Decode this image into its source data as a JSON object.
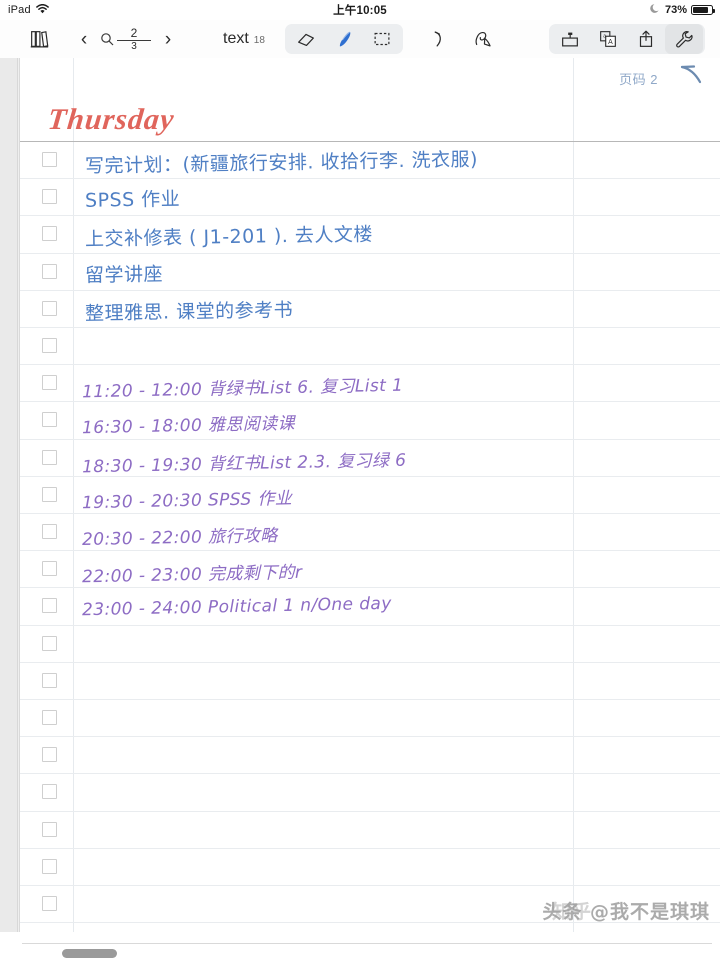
{
  "statusbar": {
    "device": "iPad",
    "wifi_icon": "wifi-icon",
    "time": "上午10:05",
    "dnd_icon": "moon-icon",
    "battery_percent": "73%"
  },
  "toolbar": {
    "library_label": "library-icon",
    "prev_label": "‹",
    "next_label": "›",
    "search_icon": "search-icon",
    "page_current": "2",
    "page_total": "3",
    "text_label": "text",
    "text_size": "18",
    "eraser_label": "eraser-icon",
    "pen_label": "pen-icon",
    "lasso_label": "lasso-select-icon",
    "undo_label": "undo-icon",
    "shape_label": "shape-tool-icon",
    "insert_label": "insert-page-icon",
    "copy_label": "copy-page-icon",
    "share_label": "share-icon",
    "settings_label": "wrench-icon"
  },
  "page": {
    "page_number_label": "页码 2",
    "title": "Thursday",
    "accent_title_color": "#e0655c",
    "ink_blue": "#4f7fc4",
    "ink_purple": "#8d6cc4",
    "tasks": [
      {
        "text": "写完计划：(新疆旅行安排. 收拾行李. 洗衣服)",
        "ink": "blue",
        "checked": false
      },
      {
        "text": "SPSS 作业",
        "ink": "blue",
        "checked": false
      },
      {
        "text": "上交补修表 ( J1-201 ). 去人文楼",
        "ink": "blue",
        "checked": false
      },
      {
        "text": "留学讲座",
        "ink": "blue",
        "checked": false
      },
      {
        "text": "整理雅思. 课堂的参考书",
        "ink": "blue",
        "checked": false
      },
      {
        "text": "",
        "ink": "blue",
        "checked": false
      },
      {
        "text": "11:20 - 12:00 背绿书List 6. 复习List 1",
        "ink": "purple",
        "checked": false
      },
      {
        "text": "16:30 - 18:00 雅思阅读课",
        "ink": "purple",
        "checked": false
      },
      {
        "text": "18:30 - 19:30 背红书List 2.3. 复习绿 6",
        "ink": "purple",
        "checked": false
      },
      {
        "text": "19:30 - 20:30 SPSS 作业",
        "ink": "purple",
        "checked": false
      },
      {
        "text": "20:30 - 22:00 旅行攻略",
        "ink": "purple",
        "checked": false
      },
      {
        "text": "22:00 - 23:00 完成剩下的r",
        "ink": "purple",
        "checked": false
      },
      {
        "text": "23:00 - 24:00 Political 1    n/One day",
        "ink": "purple",
        "checked": false
      },
      {
        "text": "",
        "ink": "blue",
        "checked": false
      },
      {
        "text": "",
        "ink": "blue",
        "checked": false
      },
      {
        "text": "",
        "ink": "blue",
        "checked": false
      },
      {
        "text": "",
        "ink": "blue",
        "checked": false
      },
      {
        "text": "",
        "ink": "blue",
        "checked": false
      },
      {
        "text": "",
        "ink": "blue",
        "checked": false
      },
      {
        "text": "",
        "ink": "blue",
        "checked": false
      },
      {
        "text": "",
        "ink": "blue",
        "checked": false
      },
      {
        "text": "",
        "ink": "blue",
        "checked": false
      }
    ]
  },
  "watermark": {
    "primary": "头条 @我不是琪琪",
    "ghost": "知乎"
  }
}
